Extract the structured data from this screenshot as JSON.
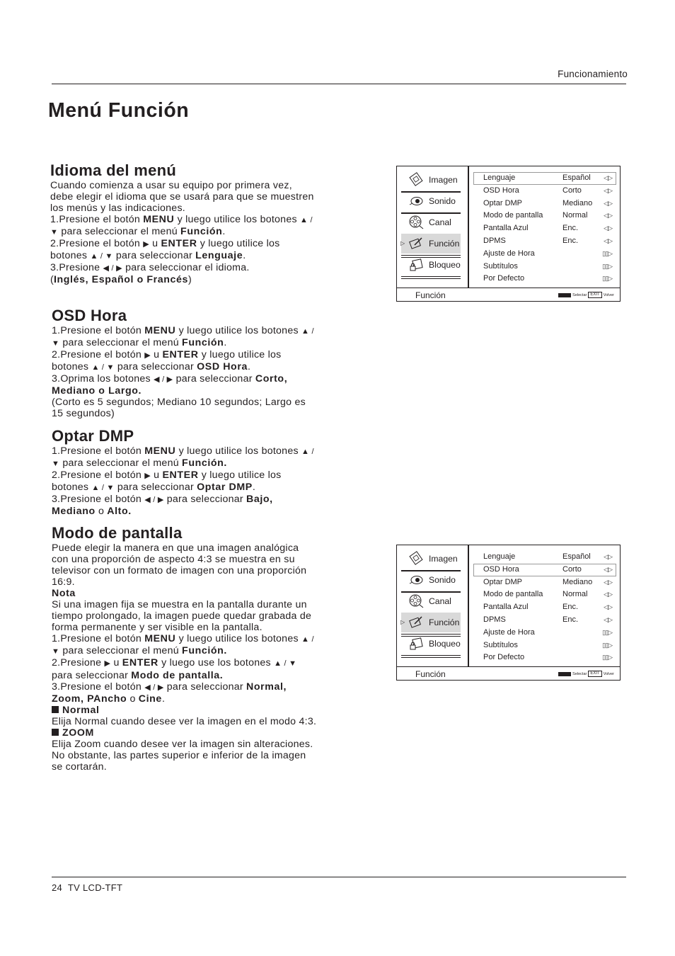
{
  "header": {
    "running_head": "Funcionamiento",
    "page_title": "Menú Función"
  },
  "sections": {
    "idioma": {
      "title": "Idioma del menú",
      "intro": "Cuando comienza a usar su equipo por primera vez, debe elegir el idioma que se usará para que se muestren los menús y las indicaciones.",
      "step1_pre": "1.Presione el botón ",
      "step1_b1": "MENU",
      "step1_mid": " y luego utilice los botones ",
      "step1_arrows": "▲ / ▼",
      "step1_post": " para seleccionar el menú ",
      "step1_b2": "Función",
      "step1_end": ".",
      "step2_pre": "2.Presione el botón ",
      "step2_arrow": "▶",
      "step2_u": " u ",
      "step2_b1": "ENTER",
      "step2_mid": " y luego utilice los botones ",
      "step2_arrows": "▲ / ▼",
      "step2_post": " para seleccionar ",
      "step2_b2": "Lenguaje",
      "step2_end": ".",
      "step3_pre": "3.Presione ",
      "step3_arrows": "◀ / ▶",
      "step3_post": " para seleccionar el idioma.",
      "options_open": "(",
      "options_b": "Inglés, Español o Francés",
      "options_close": ")"
    },
    "osd_hora": {
      "title": "OSD Hora",
      "step1_pre": "1.Presione el botón ",
      "step1_b1": "MENU",
      "step1_mid": " y luego utilice los botones ",
      "step1_arrows": "▲ / ▼",
      "step1_post": " para seleccionar el menú ",
      "step1_b2": "Función",
      "step1_end": ".",
      "step2_pre": "2.Presione el botón ",
      "step2_arrow": "▶",
      "step2_u": " u ",
      "step2_b1": "ENTER",
      "step2_mid": " y luego utilice los botones ",
      "step2_arrows": "▲ / ▼",
      "step2_post": " para seleccionar ",
      "step2_b2": "OSD Hora",
      "step2_end": ".",
      "step3_pre": "3.Oprima los botones ",
      "step3_arrows": "◀ / ▶",
      "step3_post": " para seleccionar ",
      "step3_b": "Corto, Mediano o Largo.",
      "note": "(Corto es 5 segundos; Mediano 10 segundos; Largo es 15 segundos)"
    },
    "optar_dmp": {
      "title": "Optar DMP",
      "step1_pre": "1.Presione el botón ",
      "step1_b1": "MENU",
      "step1_mid": " y luego utilice los botones ",
      "step1_arrows": "▲ / ▼",
      "step1_post": " para seleccionar el menú ",
      "step1_b2": "Función.",
      "step2_pre": "2.Presione el botón ",
      "step2_arrow": "▶",
      "step2_u": " u ",
      "step2_b1": "ENTER",
      "step2_mid": " y luego utilice los botones ",
      "step2_arrows": "▲ / ▼",
      "step2_post": " para seleccionar ",
      "step2_b2": "Optar DMP",
      "step2_end": ".",
      "step3_pre": "3.Presione el botón ",
      "step3_arrows": "◀ / ▶",
      "step3_post": " para seleccionar ",
      "step3_b1": "Bajo, Mediano",
      "step3_o": " o ",
      "step3_b2": "Alto."
    },
    "modo_pantalla": {
      "title": "Modo de pantalla",
      "intro": "Puede elegir la manera en que una imagen analógica con una proporción de aspecto 4:3 se muestra en su televisor con un formato de imagen con una proporción 16:9.",
      "note_title": "Nota",
      "note_text": "Si una imagen fija se muestra en la pantalla durante un tiempo prolongado, la imagen puede quedar grabada de forma permanente y ser visible en la pantalla.",
      "step1_pre": "1.Presione el botón ",
      "step1_b1": "MENU",
      "step1_mid": " y luego utilice los botones ",
      "step1_arrows": "▲ / ▼",
      "step1_post": " para seleccionar el menú ",
      "step1_b2": "Función.",
      "step2_pre": "2.Presione ",
      "step2_arrow": "▶",
      "step2_u": " u ",
      "step2_b1": "ENTER",
      "step2_mid": " y luego use los botones ",
      "step2_arrows": "▲ / ▼",
      "step2_post": " para seleccionar ",
      "step2_b2": "Modo de pantalla.",
      "step3_pre": "3.Presione el botón ",
      "step3_arrows": "◀ / ▶",
      "step3_post": " para seleccionar ",
      "step3_b1": "Normal, Zoom, PAncho",
      "step3_o": " o ",
      "step3_b2": "Cine",
      "step3_end": ".",
      "normal_title": "Normal",
      "normal_text": "Elija Normal cuando desee ver la imagen en el modo 4:3.",
      "zoom_title": "ZOOM",
      "zoom_text": "Elija Zoom cuando desee ver la imagen sin alteraciones. No obstante, las partes superior e inferior de la imagen se cortarán."
    }
  },
  "osd_menus": [
    {
      "sidebar": [
        "Imagen",
        "Sonido",
        "Canal",
        "Función",
        "Bloqueo"
      ],
      "active_sidebar": "Función",
      "selected_row": "Lenguaje",
      "rows": [
        {
          "name": "Lenguaje",
          "value": "Español",
          "arrow": "◁▷"
        },
        {
          "name": "OSD Hora",
          "value": "Corto",
          "arrow": "◁▷"
        },
        {
          "name": "Optar DMP",
          "value": "Mediano",
          "arrow": "◁▷"
        },
        {
          "name": "Modo de pantalla",
          "value": "Normal",
          "arrow": "◁▷"
        },
        {
          "name": "Pantalla Azul",
          "value": "Enc.",
          "arrow": "◁▷"
        },
        {
          "name": "DPMS",
          "value": "Enc.",
          "arrow": "◁▷"
        },
        {
          "name": "Ajuste de Hora",
          "value": "",
          "arrow": "▯▯▷"
        },
        {
          "name": "Subtítulos",
          "value": "",
          "arrow": "▯▯▷"
        },
        {
          "name": "Por Defecto",
          "value": "",
          "arrow": "▯▯▷"
        }
      ],
      "footer_label": "Función",
      "hint_select": "Selectar",
      "hint_exit_key": "EXIT",
      "hint_back": "Volver"
    },
    {
      "sidebar": [
        "Imagen",
        "Sonido",
        "Canal",
        "Función",
        "Bloqueo"
      ],
      "active_sidebar": "Función",
      "selected_row": "OSD Hora",
      "rows": [
        {
          "name": "Lenguaje",
          "value": "Español",
          "arrow": "◁▷"
        },
        {
          "name": "OSD Hora",
          "value": "Corto",
          "arrow": "◁▷"
        },
        {
          "name": "Optar DMP",
          "value": "Mediano",
          "arrow": "◁▷"
        },
        {
          "name": "Modo de pantalla",
          "value": "Normal",
          "arrow": "◁▷"
        },
        {
          "name": "Pantalla Azul",
          "value": "Enc.",
          "arrow": "◁▷"
        },
        {
          "name": "DPMS",
          "value": "Enc.",
          "arrow": "◁▷"
        },
        {
          "name": "Ajuste de Hora",
          "value": "",
          "arrow": "▯▯▷"
        },
        {
          "name": "Subtítulos",
          "value": "",
          "arrow": "▯▯▷"
        },
        {
          "name": "Por Defecto",
          "value": "",
          "arrow": "▯▯▷"
        }
      ],
      "footer_label": "Función",
      "hint_select": "Selectar",
      "hint_exit_key": "EXIT",
      "hint_back": "Volver"
    }
  ],
  "footer": {
    "page_number": "24",
    "product": "TV LCD-TFT"
  }
}
